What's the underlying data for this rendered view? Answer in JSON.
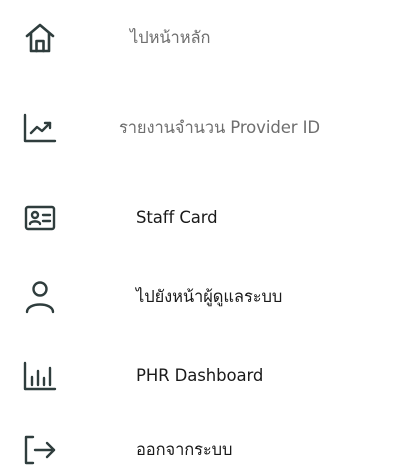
{
  "menu": {
    "icon_color": "#2f3d3d",
    "items": [
      {
        "label": "ไปหน้าหลัก",
        "icon": "home-icon"
      },
      {
        "label": "รายงานจำนวน Provider ID",
        "icon": "trending-chart-icon"
      },
      {
        "label": "Staff Card",
        "icon": "id-card-icon"
      },
      {
        "label": "ไปยังหน้าผู้ดูแลระบบ",
        "icon": "user-icon"
      },
      {
        "label": "PHR Dashboard",
        "icon": "bar-chart-icon"
      },
      {
        "label": "ออกจากระบบ",
        "icon": "logout-icon"
      }
    ]
  }
}
